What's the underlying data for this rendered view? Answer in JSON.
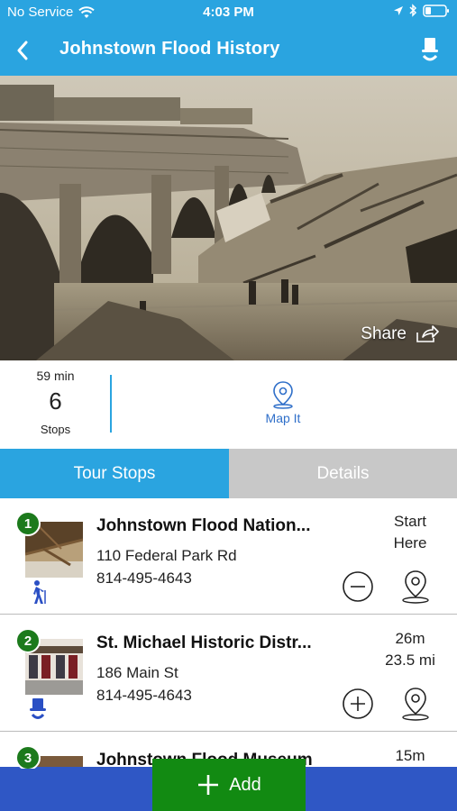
{
  "status_bar": {
    "carrier": "No Service",
    "time": "4:03 PM"
  },
  "nav": {
    "title": "Johnstown Flood History"
  },
  "hero": {
    "share_label": "Share"
  },
  "summary": {
    "duration": "59 min",
    "stop_count": "6",
    "stops_label": "Stops",
    "map_label": "Map It"
  },
  "tabs": [
    {
      "label": "Tour Stops",
      "active": true
    },
    {
      "label": "Details",
      "active": false
    }
  ],
  "stops": [
    {
      "number": "1",
      "name": "Johnstown Flood Nation...",
      "address": "110 Federal Park Rd",
      "phone": "814-495-4643",
      "time_line1": "Start",
      "time_line2": "Here",
      "mode_icon": "walking-person-icon",
      "action_icon": "remove-circle-icon"
    },
    {
      "number": "2",
      "name": "St. Michael Historic Distr...",
      "address": "186 Main St",
      "phone": "814-495-4643",
      "time_line1": "26m",
      "time_line2": "23.5 mi",
      "mode_icon": "top-hat-icon",
      "action_icon": "add-circle-icon"
    },
    {
      "number": "3",
      "name": "Johnstown Flood Museum",
      "time_line1": "15m"
    }
  ],
  "bottom": {
    "add_label": "Add"
  },
  "colors": {
    "primary_blue": "#2aa4e0",
    "bottom_bar_blue": "#2f57c5",
    "add_green": "#128a12",
    "stop_badge_green": "#1c7a1c",
    "tab_inactive_gray": "#c8c8c8"
  }
}
